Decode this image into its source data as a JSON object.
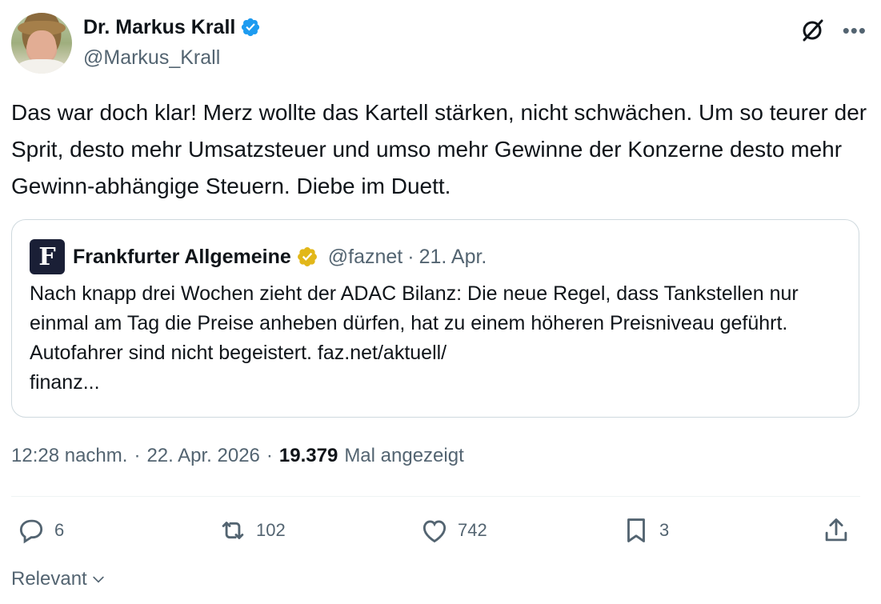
{
  "author": {
    "display_name": "Dr. Markus Krall",
    "handle": "@Markus_Krall"
  },
  "tweet": {
    "text": "Das war doch klar! Merz wollte das Kartell stärken, nicht schwächen. Um so teurer der Sprit, desto mehr Umsatzsteuer und umso mehr Gewinne der Konzerne desto mehr Gewinn-abhängige Steuern. Diebe im Duett."
  },
  "quote": {
    "logo_letter": "F",
    "display_name": "Frankfurter Allgemeine",
    "handle": "@faznet",
    "separator": "·",
    "date": "21. Apr.",
    "text": "Nach knapp drei Wochen zieht der ADAC Bilanz: Die neue Regel, dass Tankstellen nur einmal am Tag die Preise anheben dürfen, hat zu einem höheren Preisniveau geführt. Autofahrer sind nicht begeistert. faz.net/aktuell/\nfinanz..."
  },
  "meta": {
    "time": "12:28 nachm.",
    "sep1": "·",
    "date": "22. Apr. 2026",
    "sep2": "·",
    "views": "19.379",
    "views_label": "Mal angezeigt"
  },
  "actions": {
    "replies": "6",
    "reposts": "102",
    "likes": "742",
    "bookmarks": "3"
  },
  "sort": {
    "label": "Relevant"
  },
  "icons": [
    "verified-badge-icon",
    "grok-icon",
    "more-icon",
    "gold-badge-icon",
    "reply-icon",
    "repost-icon",
    "like-icon",
    "bookmark-icon",
    "share-icon",
    "chevron-down-icon"
  ],
  "colors": {
    "verified_blue": "#1d9bf0",
    "gold": "#e2b719",
    "muted": "#536471"
  }
}
